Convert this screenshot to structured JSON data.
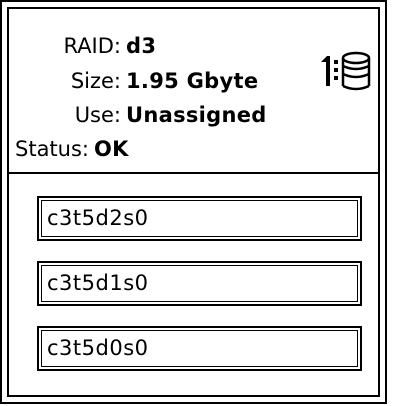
{
  "raid": {
    "labels": {
      "raid": "RAID:",
      "size": "Size:",
      "use": "Use:",
      "status": "Status:"
    },
    "values": {
      "raid": "d3",
      "size": "1.95 Gbyte",
      "use": "Unassigned",
      "status": "OK"
    },
    "icon": "raid-disk-stack-icon"
  },
  "components": [
    {
      "label": "c3t5d2s0"
    },
    {
      "label": "c3t5d1s0"
    },
    {
      "label": "c3t5d0s0"
    }
  ]
}
